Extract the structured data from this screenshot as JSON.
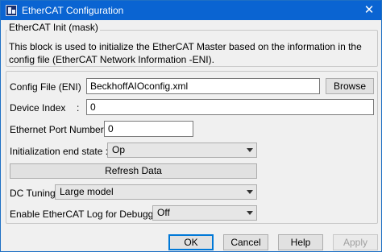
{
  "window": {
    "title": "EtherCAT Configuration",
    "close_glyph": "✕"
  },
  "mask": {
    "legend": "EtherCAT Init (mask)",
    "description": "This block is used to initialize the EtherCAT Master based on the information in the config file (EtherCAT Network Information -ENI)."
  },
  "parameters": {
    "config_file": {
      "label": "Config File (ENI)",
      "value": "BeckhoffAIOconfig.xml",
      "browse_label": "Browse"
    },
    "device_index": {
      "label": "Device Index",
      "value": "0"
    },
    "ethernet_port": {
      "label": "Ethernet Port Number:",
      "value": "0"
    },
    "init_end_state": {
      "label": "Initialization end state :",
      "selected": "Op"
    },
    "refresh_label": "Refresh Data",
    "dc_tuning": {
      "label": "DC Tuning",
      "selected": "Large model"
    },
    "log_debug": {
      "label": "Enable EtherCAT Log for Debugging",
      "selected": "Off"
    }
  },
  "footer": {
    "ok": "OK",
    "cancel": "Cancel",
    "help": "Help",
    "apply": "Apply"
  },
  "icons": [
    "app-icon",
    "close-icon",
    "dropdown-arrow-icon"
  ]
}
